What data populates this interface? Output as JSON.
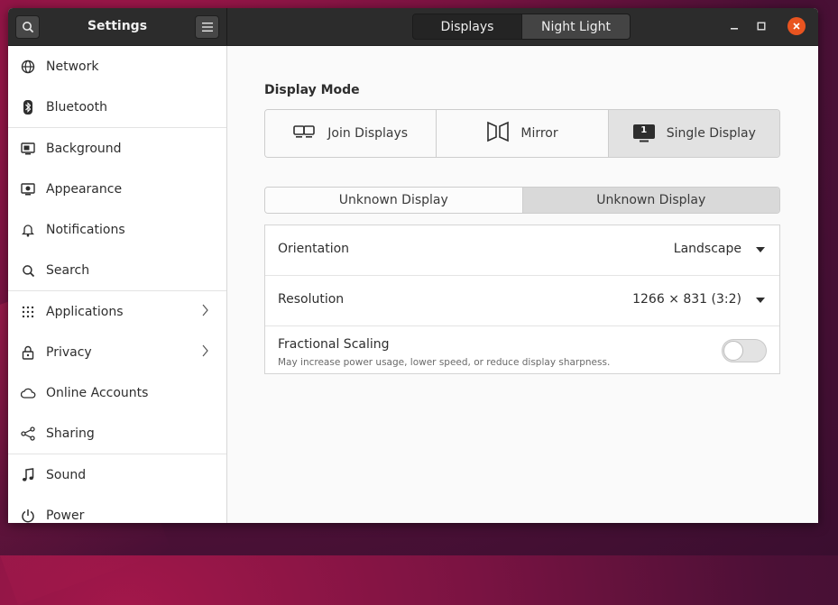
{
  "headerbar": {
    "title": "Settings",
    "tabs": [
      {
        "label": "Displays",
        "active": true
      },
      {
        "label": "Night Light",
        "active": false
      }
    ]
  },
  "sidebar": {
    "items": [
      {
        "label": "Network",
        "icon": "network-globe-icon"
      },
      {
        "label": "Bluetooth",
        "icon": "bluetooth-icon"
      },
      {
        "label": "Background",
        "icon": "background-icon"
      },
      {
        "label": "Appearance",
        "icon": "appearance-icon"
      },
      {
        "label": "Notifications",
        "icon": "bell-icon"
      },
      {
        "label": "Search",
        "icon": "search-icon"
      },
      {
        "label": "Applications",
        "icon": "grid-icon",
        "has_submenu": true
      },
      {
        "label": "Privacy",
        "icon": "lock-icon",
        "has_submenu": true
      },
      {
        "label": "Online Accounts",
        "icon": "cloud-icon"
      },
      {
        "label": "Sharing",
        "icon": "share-icon"
      },
      {
        "label": "Sound",
        "icon": "music-note-icon"
      },
      {
        "label": "Power",
        "icon": "power-icon"
      }
    ]
  },
  "content": {
    "display_mode_title": "Display Mode",
    "modes": [
      {
        "label": "Join Displays",
        "icon": "join-displays-icon"
      },
      {
        "label": "Mirror",
        "icon": "mirror-icon"
      },
      {
        "label": "Single Display",
        "icon": "single-display-icon",
        "selected": true,
        "badge": "1"
      }
    ],
    "display_tabs": [
      {
        "label": "Unknown Display",
        "active": false
      },
      {
        "label": "Unknown Display",
        "active": true
      }
    ],
    "orientation": {
      "label": "Orientation",
      "value": "Landscape"
    },
    "resolution": {
      "label": "Resolution",
      "value": "1266 × 831 (3:2)"
    },
    "fractional_scaling": {
      "label": "Fractional Scaling",
      "description": "May increase power usage, lower speed, or reduce display sharpness.",
      "enabled": false
    }
  },
  "colors": {
    "accent": "#e95420",
    "headerbar": "#2c2c2c"
  }
}
